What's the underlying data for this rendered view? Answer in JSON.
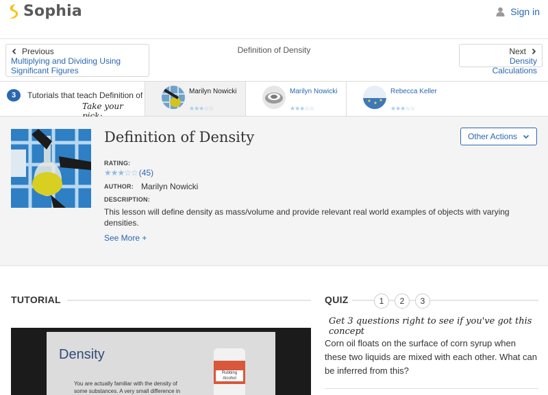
{
  "header": {
    "logo_text": "Sophia",
    "signin_label": "Sign in",
    "brand_color": "#f5c518",
    "link_color": "#2a67b1"
  },
  "nav": {
    "previous_label": "Previous",
    "previous_link": "Multiplying and Dividing Using Significant Figures",
    "current_title": "Definition of Density",
    "next_label": "Next",
    "next_link": "Density Calculations"
  },
  "chooser": {
    "count": "3",
    "title": "Tutorials that teach Definition of Density",
    "subtitle": "Take your pick:",
    "tutorials": [
      {
        "author": "Marilyn Nowicki",
        "rating_stars": 3,
        "active": true
      },
      {
        "author": "Marilyn Nowicki",
        "rating_stars": 3,
        "active": false
      },
      {
        "author": "Rebecca Keller",
        "rating_stars": 3,
        "active": false
      }
    ]
  },
  "lesson": {
    "title": "Definition of Density",
    "other_actions_label": "Other Actions",
    "rating_label": "RATING:",
    "rating_stars": 3,
    "rating_count": "(45)",
    "author_label": "AUTHOR:",
    "author": "Marilyn Nowicki",
    "description_label": "DESCRIPTION:",
    "description": "This lesson will define density as mass/volume and provide relevant real world examples of objects with varying densities.",
    "see_more": "See More +"
  },
  "tutorial": {
    "heading": "TUTORIAL",
    "slide_title": "Density",
    "slide_text": "You are actually familiar with the density of some substances. A very small difference in liquids can cause them to separate into",
    "bottle_text": "Rubbing Alcohol"
  },
  "quiz": {
    "heading": "QUIZ",
    "steps": [
      "1",
      "2",
      "3"
    ],
    "hint": "Get 3 questions right to see if you've got this concept",
    "question": "Corn oil floats on the surface of corn syrup when these two liquids are mixed with each other. What can be inferred from this?"
  }
}
